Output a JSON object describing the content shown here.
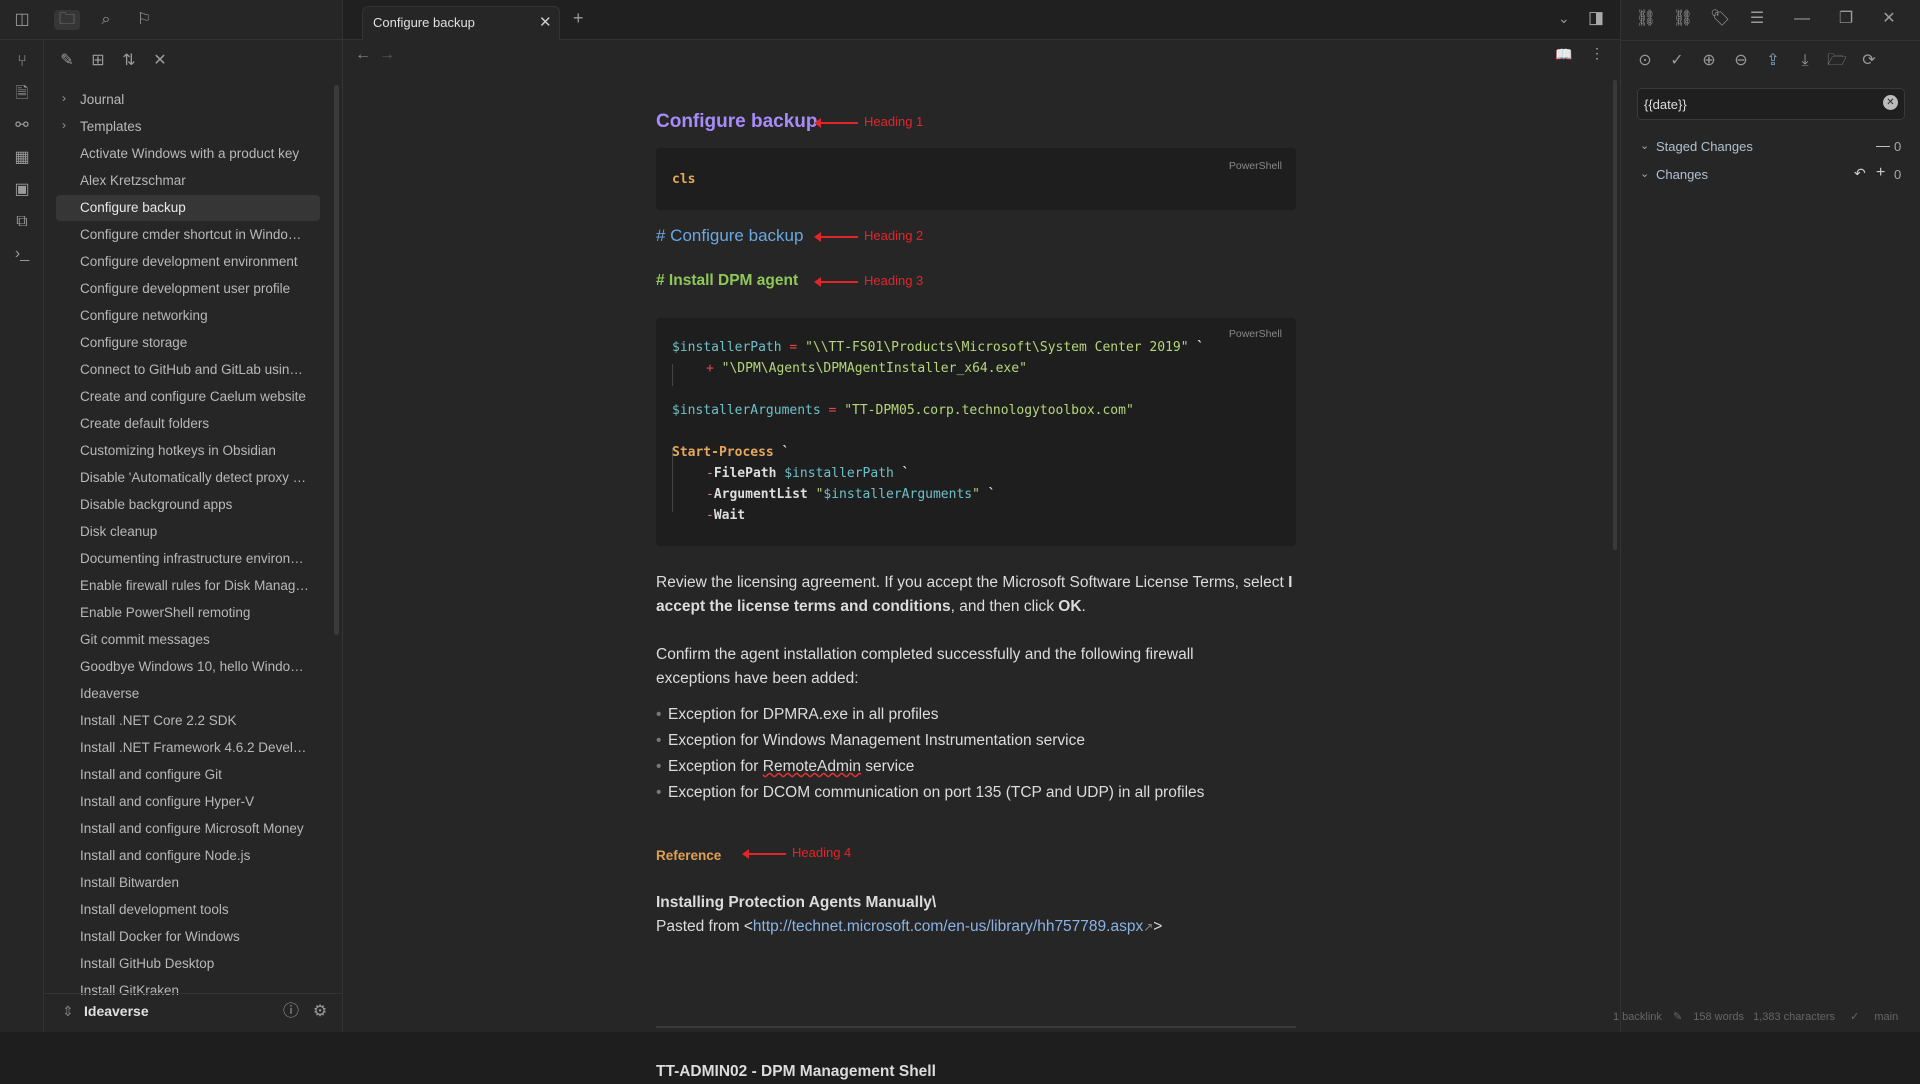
{
  "ribbon": {
    "icons": [
      "sidebar-toggle-icon",
      "git-branch-icon",
      "file-search-icon",
      "graph-icon",
      "dashboard-icon",
      "calendar-icon",
      "copy-icon",
      "terminal-icon"
    ]
  },
  "sidebar": {
    "nav_icons": [
      "folder-icon",
      "search-icon",
      "bookmark-icon"
    ],
    "toolbar_icons": [
      "new-note-icon",
      "new-folder-icon",
      "sort-icon",
      "collapse-icon"
    ],
    "folders": [
      "Journal",
      "Templates"
    ],
    "files": [
      "Activate Windows with a product key",
      "Alex Kretzschmar",
      "Configure backup",
      "Configure cmder shortcut in Windows ...",
      "Configure development environment",
      "Configure development user profile",
      "Configure networking",
      "Configure storage",
      "Connect to GitHub and GitLab using S...",
      "Create and configure Caelum website",
      "Create default folders",
      "Customizing hotkeys in Obsidian",
      "Disable 'Automatically detect proxy set...",
      "Disable background apps",
      "Disk cleanup",
      "Documenting infrastructure environme...",
      "Enable firewall rules for Disk Managem...",
      "Enable PowerShell remoting",
      "Git commit messages",
      "Goodbye Windows 10, hello Windows ...",
      "Ideaverse",
      "Install .NET Core 2.2 SDK",
      "Install .NET Framework 4.6.2 Developer...",
      "Install and configure Git",
      "Install and configure Hyper-V",
      "Install and configure Microsoft Money",
      "Install and configure Node.js",
      "Install Bitwarden",
      "Install development tools",
      "Install Docker for Windows",
      "Install GitHub Desktop",
      "Install GitKraken"
    ],
    "active_file": "Configure backup",
    "vault_name": "Ideaverse"
  },
  "tab": {
    "title": "Configure backup"
  },
  "note": {
    "h1": "Configure backup",
    "anno1": "Heading 1",
    "code1_lang": "PowerShell",
    "code1": "cls",
    "h2": "# Configure backup",
    "anno2": "Heading 2",
    "h3": "# Install DPM agent",
    "anno3": "Heading 3",
    "code2_lang": "PowerShell",
    "code2": {
      "l1a": "$installerPath",
      "l1b": " = ",
      "l1c": "\"\\\\TT-FS01\\Products\\Microsoft\\System Center 2019\"",
      "l1d": " `",
      "l2a": "+",
      "l2b": " \"\\DPM\\Agents\\DPMAgentInstaller_x64.exe\"",
      "l3a": "$installerArguments",
      "l3b": " = ",
      "l3c": "\"TT-DPM05.corp.technologytoolbox.com\"",
      "l4a": "Start-Process",
      "l4b": " `",
      "l5a": "-",
      "l5b": "FilePath",
      "l5c": " $installerPath",
      "l5d": " `",
      "l6a": "-",
      "l6b": "ArgumentList",
      "l6c": " \"",
      "l6d": "$installerArguments",
      "l6e": "\"",
      "l6f": " `",
      "l7a": "-",
      "l7b": "Wait"
    },
    "p1a": "Review the licensing agreement. If you accept the Microsoft Software License Terms, select ",
    "p1b": "I accept the license terms and conditions",
    "p1c": ", and then click ",
    "p1d": "OK",
    ".": "",
    "p2": "Confirm the agent installation completed successfully and the following firewall exceptions have been added:",
    "bullets": [
      "Exception for DPMRA.exe in all profiles",
      "Exception for Windows Management Instrumentation service",
      "Exception for ",
      "Exception for DCOM communication on port 135 (TCP and UDP) in all profiles"
    ],
    "bullet3_word": "RemoteAdmin",
    "bullet3_tail": " service",
    "h4": "Reference",
    "anno4": "Heading 4",
    "ref_title": "Installing Protection Agents Manually\\",
    "pasted": "Pasted from <",
    "link": "http://technet.microsoft.com/en-us/library/hh757789.aspx",
    "pasted_end": ">",
    "next_heading": "TT-ADMIN02 - DPM Management Shell"
  },
  "git": {
    "commit_message": "{{date}}",
    "staged_label": "Staged Changes",
    "staged_count": "0",
    "changes_label": "Changes",
    "changes_count": "0"
  },
  "status": {
    "backlinks": "1 backlink",
    "words": "158 words",
    "chars": "1,383 characters",
    "branch": "main"
  }
}
